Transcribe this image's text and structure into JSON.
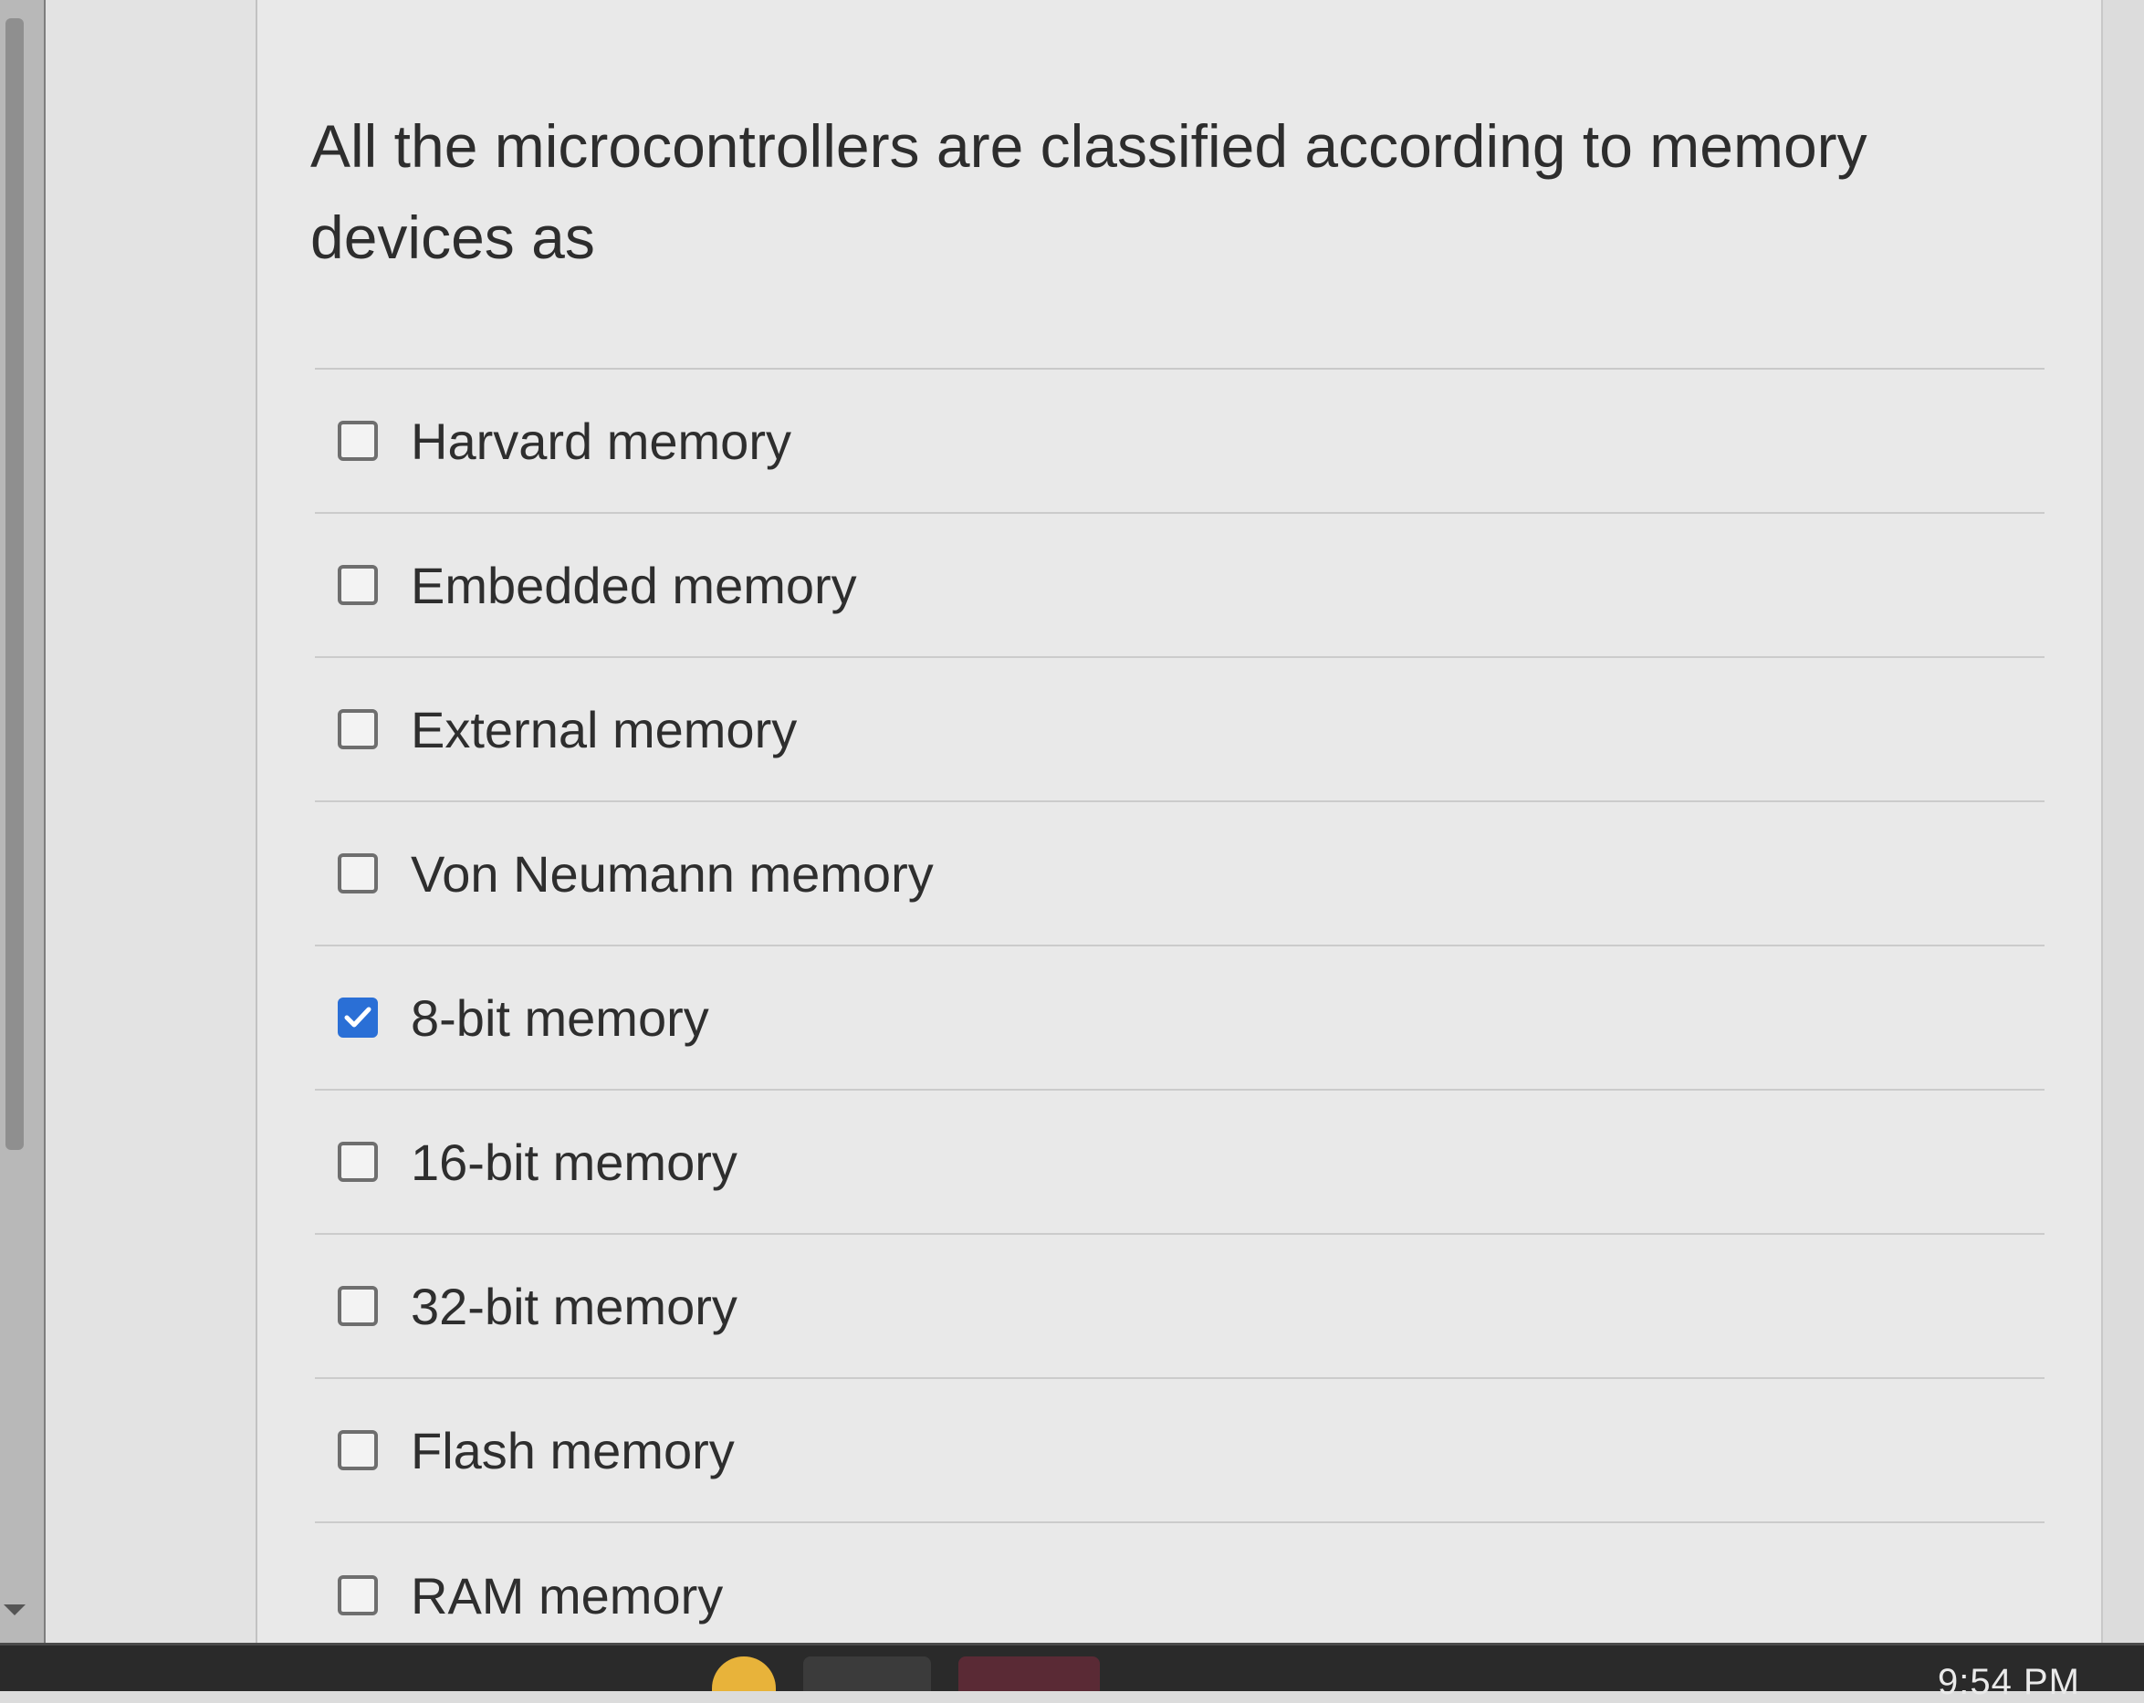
{
  "question": {
    "text": "All the microcontrollers are classified according to memory devices as"
  },
  "options": [
    {
      "label": "Harvard memory",
      "checked": false
    },
    {
      "label": "Embedded memory",
      "checked": false
    },
    {
      "label": "External memory",
      "checked": false
    },
    {
      "label": "Von Neumann memory",
      "checked": false
    },
    {
      "label": "8-bit memory",
      "checked": true
    },
    {
      "label": "16-bit memory",
      "checked": false
    },
    {
      "label": "32-bit memory",
      "checked": false
    },
    {
      "label": "Flash memory",
      "checked": false
    },
    {
      "label": "RAM memory",
      "checked": false
    }
  ],
  "taskbar": {
    "clock": "9:54 PM"
  },
  "colors": {
    "checkbox_checked": "#2a6fd6",
    "text": "#2e2e2e",
    "background": "#e9e9e9"
  }
}
